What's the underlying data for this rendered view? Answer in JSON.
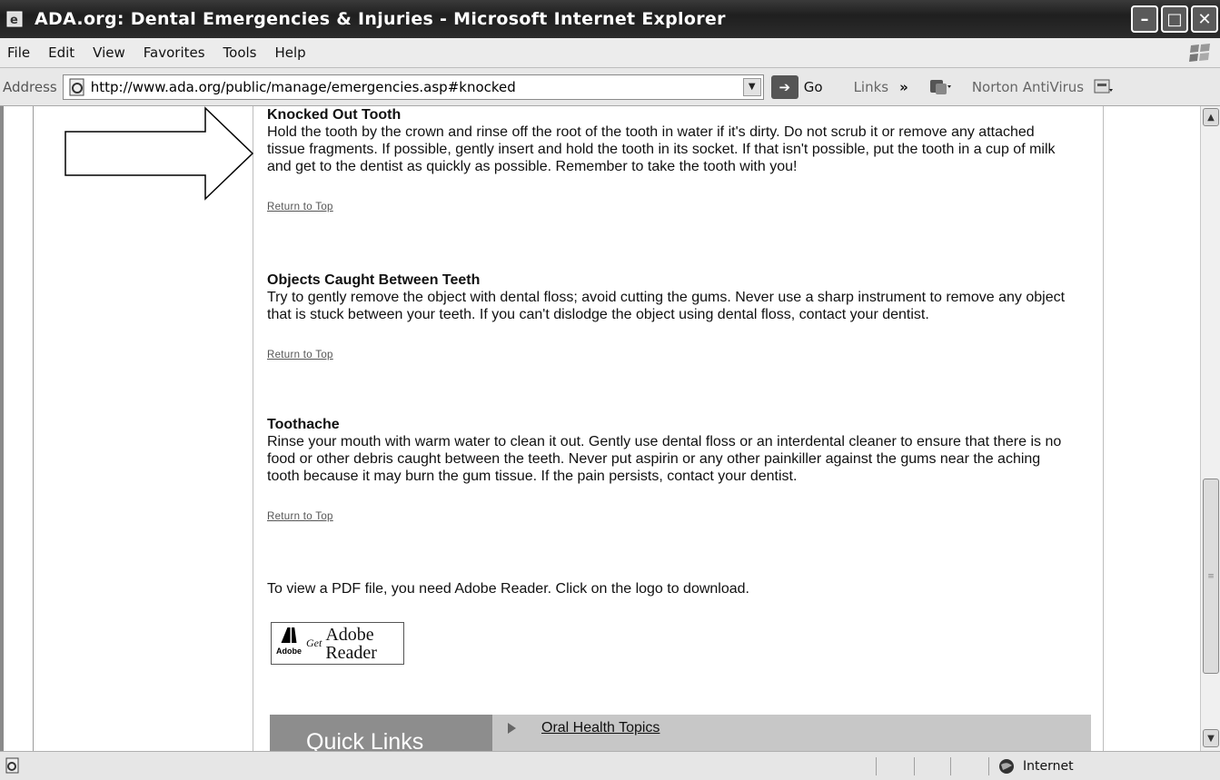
{
  "window": {
    "title": "ADA.org: Dental Emergencies & Injuries - Microsoft Internet Explorer",
    "buttons": [
      "minimize-icon",
      "maximize-icon",
      "close-icon"
    ]
  },
  "menubar": {
    "items": [
      "File",
      "Edit",
      "View",
      "Favorites",
      "Tools",
      "Help"
    ]
  },
  "addressbar": {
    "label": "Address",
    "url": "http://www.ada.org/public/manage/emergencies.asp#knocked",
    "go_label": "Go",
    "links_label": "Links",
    "links_chevron": "»",
    "norton_label": "Norton AntiVirus"
  },
  "article": {
    "sections": [
      {
        "heading": "Knocked Out Tooth",
        "body": "Hold the tooth by the crown and rinse off the root of the tooth in water if it's dirty. Do not scrub it or remove any attached tissue fragments. If possible, gently insert and hold the tooth in its socket. If that isn't possible, put the tooth in a cup of milk and get to the dentist as quickly as possible. Remember to take the tooth with you!",
        "return_link": "Return to Top"
      },
      {
        "heading": "Objects Caught Between Teeth",
        "body": "Try to gently remove the object with dental floss; avoid cutting the gums. Never use a sharp instrument to remove any object that is stuck between your teeth. If you can't dislodge the object using dental floss, contact your dentist.",
        "return_link": "Return to Top"
      },
      {
        "heading": "Toothache",
        "body": "Rinse your mouth with warm water to clean it out. Gently use dental floss or an interdental cleaner to ensure that there is no food or other debris caught between the teeth. Never put aspirin or any other painkiller against the gums near the aching tooth because it may burn the gum tissue. If the pain persists, contact your dentist.",
        "return_link": "Return to Top"
      }
    ],
    "pdf_note": "To view a PDF file, you need Adobe Reader. Click on the logo to download.",
    "adobe_logo": {
      "brand": "Adobe",
      "get": "Get",
      "line1": "Adobe",
      "line2": "Reader"
    }
  },
  "quicklinks": {
    "title": "Quick Links",
    "items": [
      "Oral Health Topics"
    ]
  },
  "statusbar": {
    "zone": "Internet"
  }
}
